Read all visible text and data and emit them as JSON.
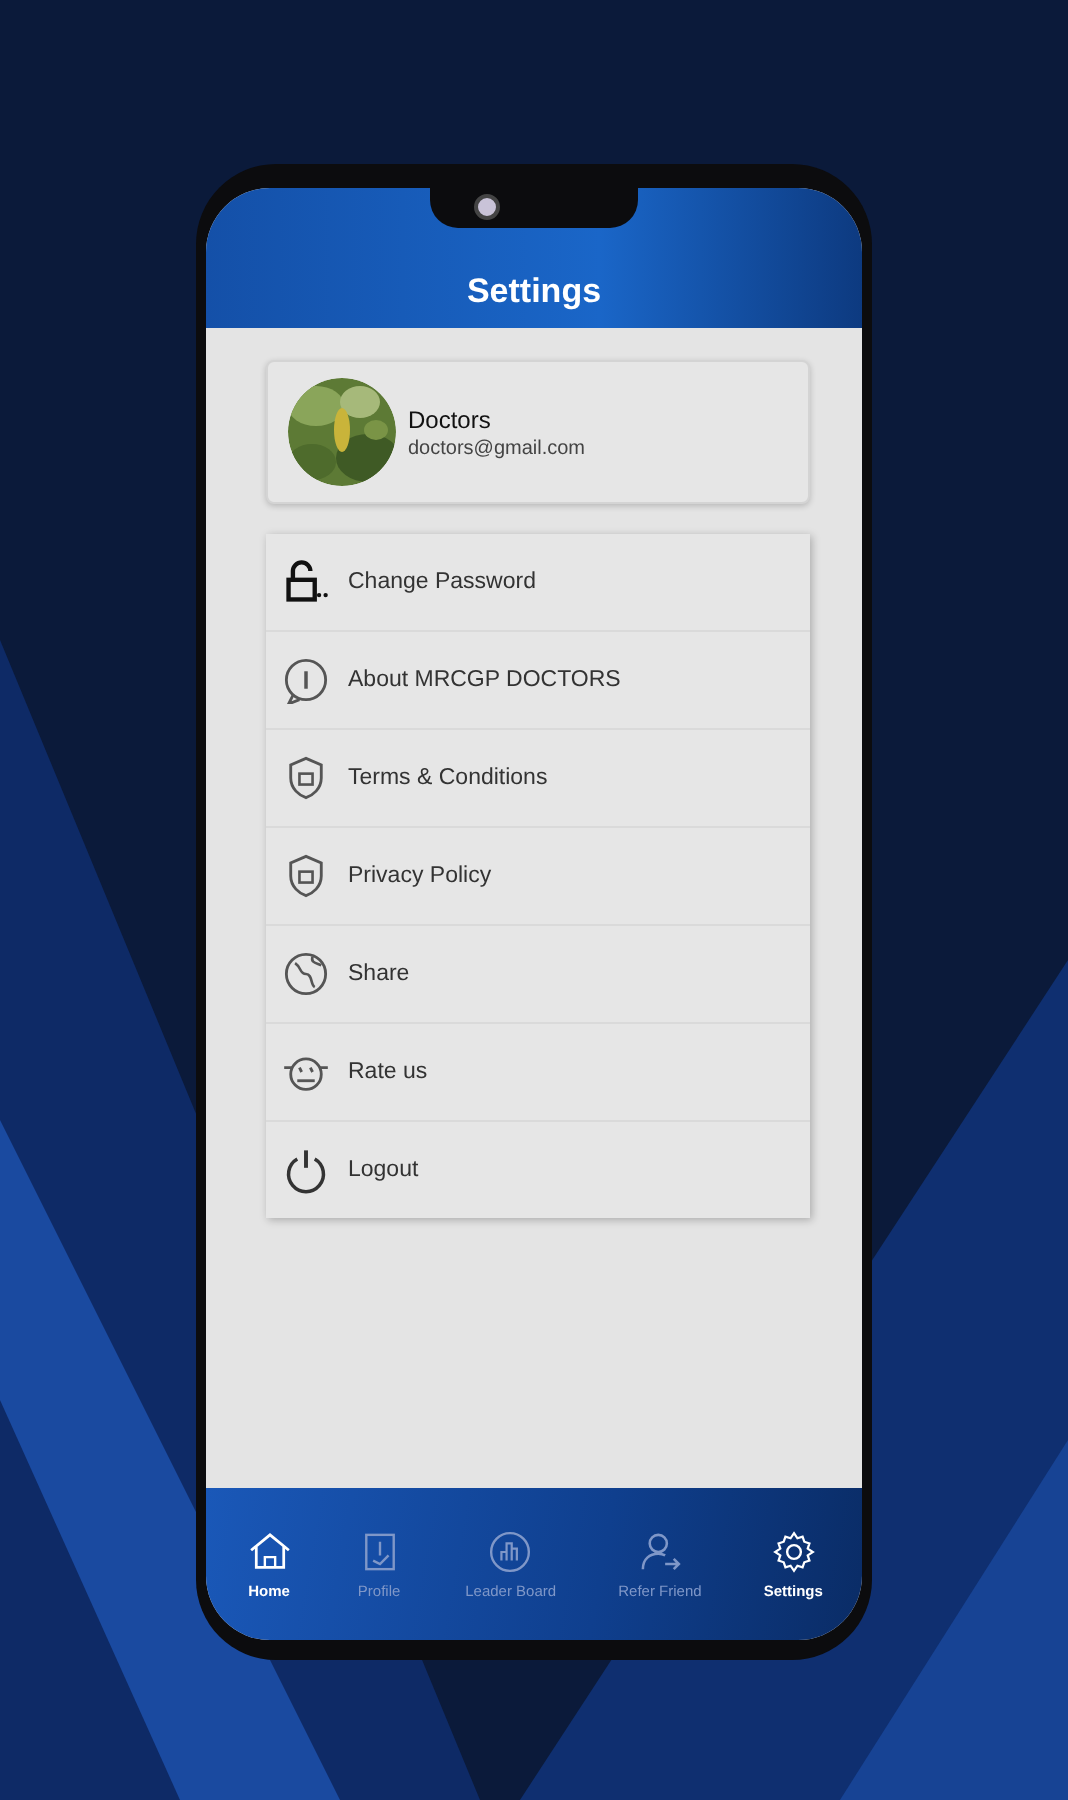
{
  "header": {
    "title": "Settings"
  },
  "profile": {
    "name": "Doctors",
    "email": "doctors@gmail.com"
  },
  "menu": [
    {
      "label": "Change Password"
    },
    {
      "label": "About MRCGP DOCTORS"
    },
    {
      "label": "Terms & Conditions"
    },
    {
      "label": "Privacy Policy"
    },
    {
      "label": "Share"
    },
    {
      "label": "Rate us"
    },
    {
      "label": "Logout"
    }
  ],
  "bottom_nav": [
    {
      "label": "Home",
      "selected": true
    },
    {
      "label": "Profile",
      "selected": false
    },
    {
      "label": "Leader Board",
      "selected": false
    },
    {
      "label": "Refer Friend",
      "selected": false
    },
    {
      "label": "Settings",
      "selected": true
    }
  ]
}
